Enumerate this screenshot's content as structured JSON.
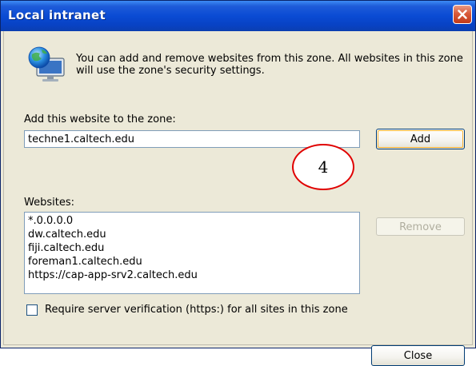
{
  "window": {
    "title": "Local intranet",
    "close_icon": "close-x-icon"
  },
  "intro": {
    "icon": "local-intranet-globe-monitor-icon",
    "text": "You can add and remove websites from this zone. All websites in this zone will use the zone's security settings."
  },
  "add_section": {
    "label": "Add this website to the zone:",
    "input_value": "techne1.caltech.edu",
    "add_button": "Add"
  },
  "websites": {
    "label": "Websites:",
    "items": [
      "*.0.0.0.0",
      "dw.caltech.edu",
      "fiji.caltech.edu",
      "foreman1.caltech.edu",
      "https://cap-app-srv2.caltech.edu"
    ],
    "remove_button": "Remove"
  },
  "verification": {
    "label": "Require server verification (https:) for all sites in this zone",
    "checked": false
  },
  "footer": {
    "close_button": "Close"
  },
  "annotation": {
    "step_number": "4"
  },
  "colors": {
    "title_bar": "#0a4bd4",
    "dialog_background": "#ece9d8",
    "annotation_circle": "#e00000",
    "close_button": "#d95a3a"
  }
}
